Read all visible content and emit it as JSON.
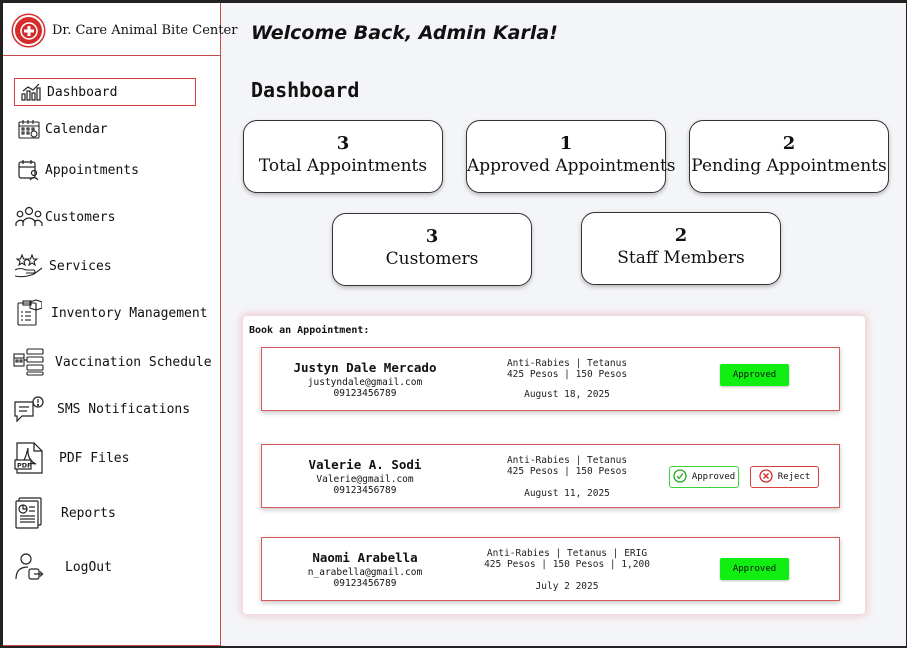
{
  "brand": {
    "name": "Dr. Care Animal Bite Center"
  },
  "sidebar": {
    "items": [
      {
        "label": "Dashboard",
        "icon": "chart-icon",
        "active": true
      },
      {
        "label": "Calendar",
        "icon": "calendar-icon"
      },
      {
        "label": "Appointments",
        "icon": "calendar-user-icon"
      },
      {
        "label": "Customers",
        "icon": "users-icon"
      },
      {
        "label": "Services",
        "icon": "hand-stars-icon"
      },
      {
        "label": "Inventory Management",
        "icon": "clipboard-box-icon"
      },
      {
        "label": "Vaccination Schedule",
        "icon": "schedule-list-icon"
      },
      {
        "label": "SMS Notifications",
        "icon": "message-alert-icon"
      },
      {
        "label": "PDF Files",
        "icon": "pdf-file-icon"
      },
      {
        "label": "Reports",
        "icon": "report-icon"
      },
      {
        "label": "LogOut",
        "icon": "logout-icon"
      }
    ]
  },
  "header": {
    "welcome": "Welcome Back, Admin Karla!",
    "page_title": "Dashboard"
  },
  "stats": [
    {
      "value": "3",
      "label": "Total Appointments"
    },
    {
      "value": "1",
      "label": "Approved Appointments"
    },
    {
      "value": "2",
      "label": "Pending Appointments"
    },
    {
      "value": "3",
      "label": "Customers"
    },
    {
      "value": "2",
      "label": "Staff Members"
    }
  ],
  "booking": {
    "title": "Book an Appointment:",
    "appointments": [
      {
        "name": "Justyn Dale Mercado",
        "email": "justyndale@gmail.com",
        "phone": "09123456789",
        "services": "Anti-Rabies | Tetanus",
        "prices": "425 Pesos | 150 Pesos",
        "date": "August 18, 2025",
        "status": "Approved"
      },
      {
        "name": "Valerie A. Sodi",
        "email": "Valerie@gmail.com",
        "phone": "09123456789",
        "services": "Anti-Rabies | Tetanus",
        "prices": "425 Pesos | 150 Pesos",
        "date": "August 11, 2025",
        "approve_label": "Approved",
        "reject_label": "Reject"
      },
      {
        "name": "Naomi Arabella",
        "email": "n_arabella@gmail.com",
        "phone": "09123456789",
        "services": "Anti-Rabies | Tetanus | ERIG",
        "prices": "425 Pesos | 150 Pesos | 1,200",
        "date": "July 2 2025",
        "status": "Approved"
      }
    ]
  },
  "colors": {
    "accent_red": "#d42b2b",
    "approved_green": "#11ee11",
    "border_red": "#d55a5a"
  }
}
